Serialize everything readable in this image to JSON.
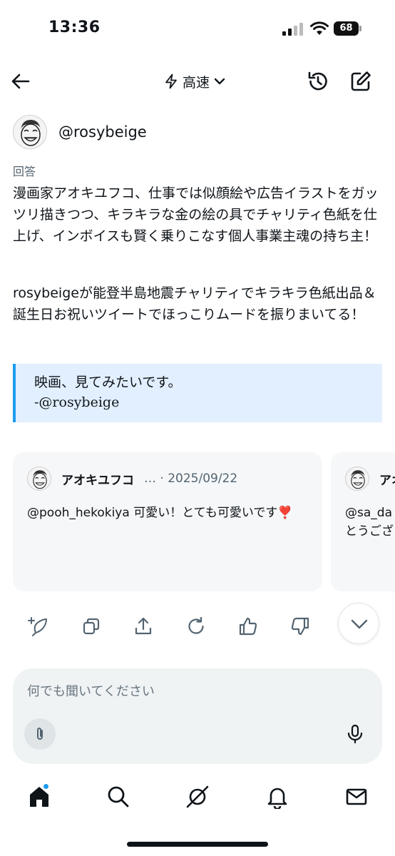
{
  "status_bar": {
    "time": "13:36",
    "battery": "68"
  },
  "topnav": {
    "mode_label": "高速"
  },
  "user": {
    "handle": "@rosybeige"
  },
  "answer": {
    "label": "回答",
    "paragraph1": "漫画家アオキユフコ、仕事では似顔絵や広告イラストをガッツリ描きつつ、キラキラな金の絵の具でチャリティ色紙を仕上げ、インボイスも賢く乗りこなす個人事業主魂の持ち主！",
    "paragraph2": "rosybeigeが能登半島地震チャリティでキラキラ色紙出品＆誕生日お祝いツイートでほっこりムードを振りまいてる！",
    "quote_line1": "映画、見てみたいです。",
    "quote_line2": "-@rosybeige"
  },
  "cards": [
    {
      "name": "アオキユフコ",
      "meta": "… · 2025/09/22",
      "text": "@pooh_hekokiya 可愛い！とても可愛いです❣️"
    },
    {
      "name": "アオ",
      "meta": "",
      "text": "@sa_da\nとうござ"
    }
  ],
  "chat": {
    "placeholder": "何でも聞いてください"
  },
  "colors": {
    "accent": "#1d9bf0",
    "quote_bg": "#e2efff",
    "card_bg": "#f5f7f8",
    "input_bg": "#eff3f4"
  }
}
